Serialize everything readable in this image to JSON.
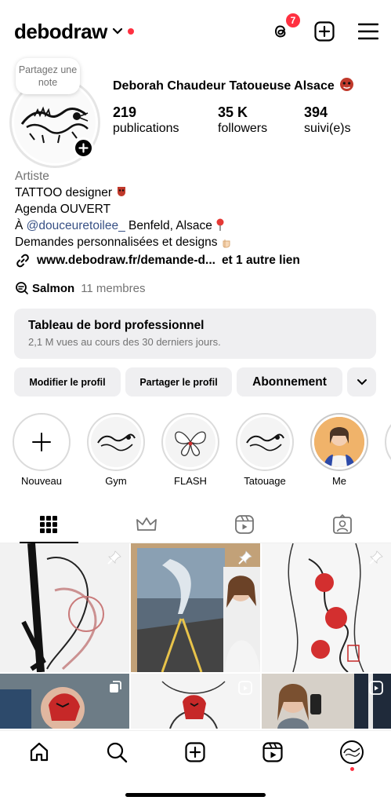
{
  "header": {
    "username": "debodraw",
    "threads_badge": "7"
  },
  "note": {
    "text": "Partagez une note"
  },
  "profile": {
    "full_name": "Deborah Chaudeur Tatoueuse Alsace"
  },
  "stats": [
    {
      "value": "219",
      "label": "publications"
    },
    {
      "value": "35 K",
      "label": "followers"
    },
    {
      "value": "394",
      "label": "suivi(e)s"
    }
  ],
  "bio": {
    "category": "Artiste",
    "line1": "TATTOO designer",
    "line2": "Agenda OUVERT",
    "line3_prefix": "À ",
    "line3_mention": "@douceuretoilee_",
    "line3_suffix": " Benfeld, Alsace",
    "line4": "Demandes personnalisées et designs"
  },
  "links": {
    "url": "www.debodraw.fr/demande-d...",
    "more": "et 1 autre lien"
  },
  "channel": {
    "name": "Salmon",
    "members": "11 membres"
  },
  "dashboard": {
    "title": "Tableau de bord professionnel",
    "subtitle": "2,1 M vues au cours des 30 derniers jours."
  },
  "actions": {
    "edit": "Modifier le profil",
    "share": "Partager le profil",
    "subscription": "Abonnement"
  },
  "highlights": [
    {
      "label": "Nouveau"
    },
    {
      "label": "Gym"
    },
    {
      "label": "FLASH"
    },
    {
      "label": "Tatouage"
    },
    {
      "label": "Me"
    }
  ],
  "tabs": [
    "grid-icon",
    "crown-icon",
    "reels-icon",
    "tagged-icon"
  ],
  "nav": [
    "home-icon",
    "search-icon",
    "create-icon",
    "reels-icon",
    "profile-avatar"
  ],
  "colors": {
    "accent_red": "#ff3040",
    "link_blue": "#385185",
    "secondary_text": "#737373",
    "button_bg": "#efeff1"
  }
}
